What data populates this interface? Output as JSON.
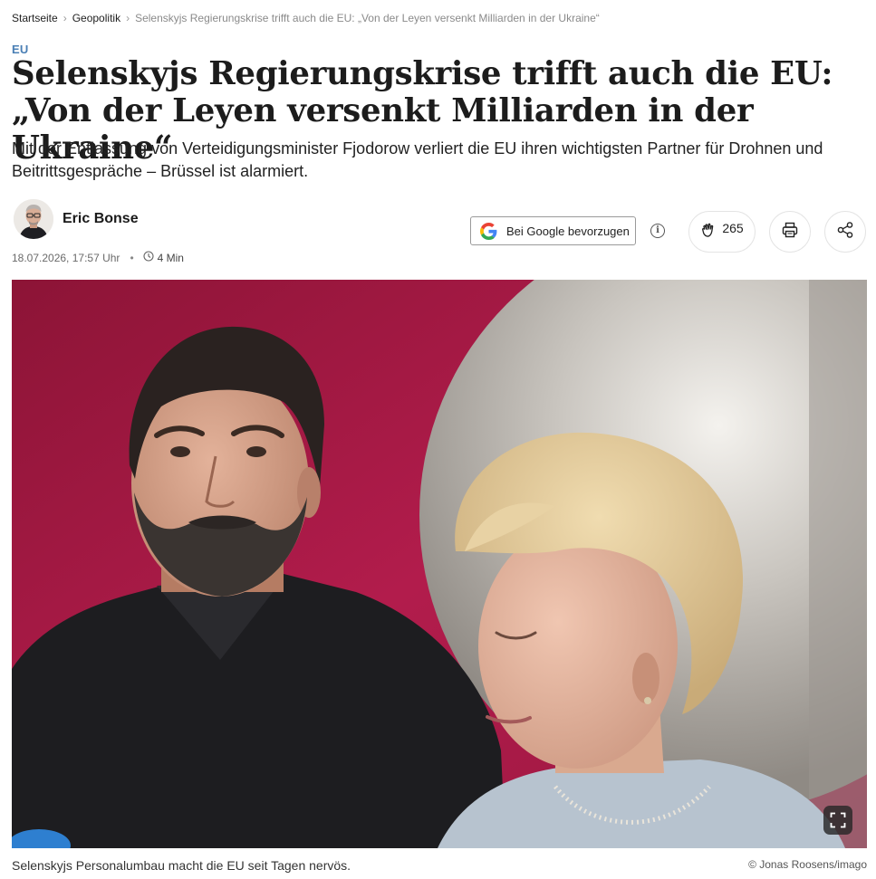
{
  "breadcrumb": {
    "items": [
      {
        "label": "Startseite"
      },
      {
        "label": "Geopolitik"
      },
      {
        "label": "Selenskyjs Regierungskrise trifft auch die EU: „Von der Leyen versenkt Milliarden in der Ukraine“"
      }
    ],
    "separator_icon": "chevron-right-icon"
  },
  "article": {
    "kicker": "EU",
    "title": "Selenskyjs Regierungskrise trifft auch die EU: „Von der Leyen versenkt Milliarden in der Ukraine“",
    "lead": "Mit der Entlassung von Verteidigungsminister Fjodorow verliert die EU ihren wichtigsten Partner für Drohnen und Beitrittsgespräche – Brüssel ist alarmiert.",
    "author": "Eric Bonse",
    "date": "18.07.2026, 17:57 Uhr",
    "read_time": "4 Min",
    "read_time_icon": "clock-icon"
  },
  "actions": {
    "google_button_label": "Bei Google bevorzugen",
    "google_icon": "google-logo-icon",
    "info_icon": "info-icon",
    "clap_icon": "clap-hands-icon",
    "clap_count": "265",
    "print_icon": "printer-icon",
    "share_icon": "share-icon"
  },
  "hero": {
    "fullscreen_icon": "fullscreen-icon",
    "caption": "Selenskyjs Personalumbau macht die EU seit Tagen nervös.",
    "credit": "© Jonas Roosens/imago"
  },
  "colors": {
    "kicker": "#4a7fb5",
    "hero_background": "#a31a45"
  }
}
